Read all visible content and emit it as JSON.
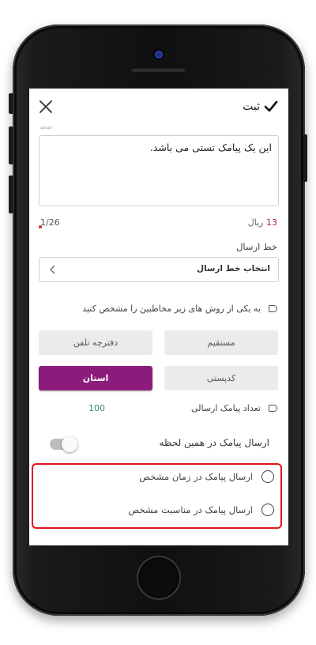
{
  "header": {
    "submit_label": "ثبت"
  },
  "message": {
    "scroll_hint": "ﺿﺿ",
    "text": "این یک پیامک تستی می باشد.",
    "cost_value": "13",
    "cost_unit": "ریال",
    "char_counter": "1/26"
  },
  "sender_line": {
    "label": "خط ارسال",
    "select_value": "انتخاب خط ارسال"
  },
  "recipients": {
    "instruction": "به یکی از روش های زیر مخاطبین را مشخص کنید",
    "methods": {
      "direct": "مستقیم",
      "phonebook": "دفترچه تلفن",
      "postal_code": "کدپستی",
      "province": "استان"
    },
    "selected": "province"
  },
  "count": {
    "label": "تعداد پیامک ارسالی",
    "value": "100"
  },
  "send_now": {
    "label": "ارسال پیامک در همین لحظه",
    "enabled": false
  },
  "schedule_options": {
    "specific_time": "ارسال پیامک در زمان مشخص",
    "specific_occasion": "ارسال پیامک در مناسبت مشخص"
  },
  "colors": {
    "accent": "#8b1c7b",
    "highlight_border": "#e3121b",
    "cost_color": "#a3244f",
    "count_color": "#2f8a7e"
  }
}
